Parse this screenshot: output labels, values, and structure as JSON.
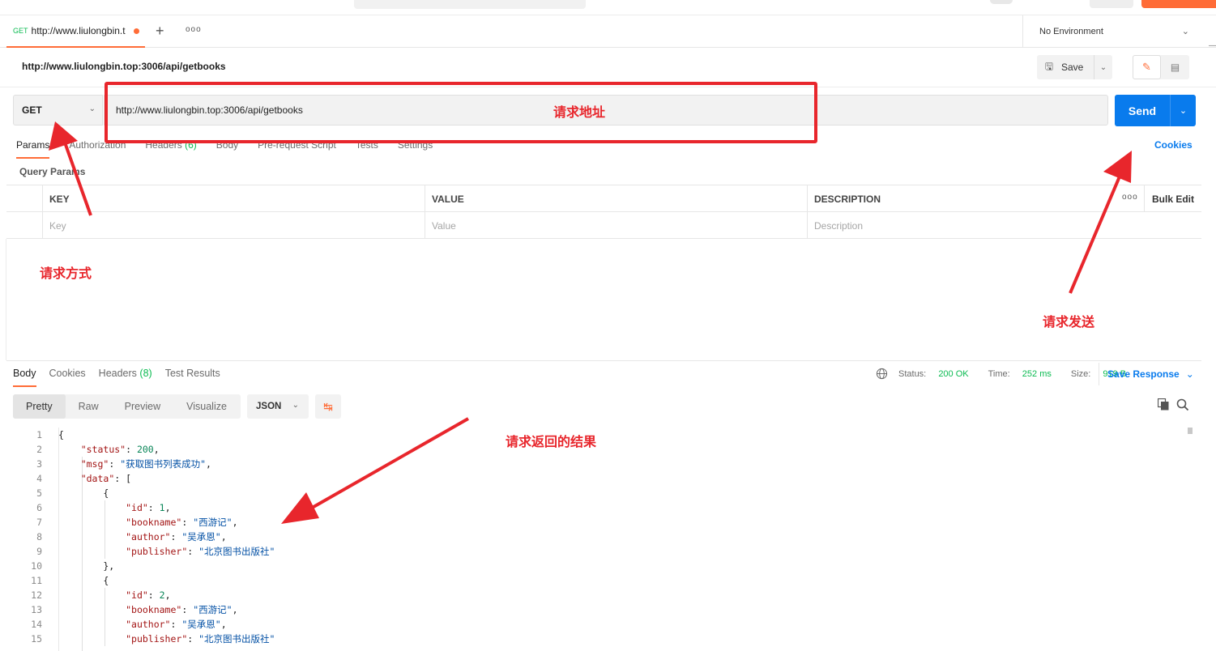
{
  "tabbar": {
    "tab_method": "GET",
    "tab_title": "http://www.liulongbin.t",
    "new_tab": "+",
    "more_tabs": "ooo",
    "environment": "No Environment"
  },
  "request": {
    "title_url": "http://www.liulongbin.top:3006/api/getbooks",
    "save_label": "Save",
    "method": "GET",
    "url": "http://www.liulongbin.top:3006/api/getbooks",
    "send_label": "Send",
    "tabs": [
      "Params",
      "Authorization",
      "Headers",
      "Body",
      "Pre-request Script",
      "Tests",
      "Settings"
    ],
    "headers_count": "(6)",
    "cookies_link": "Cookies",
    "query_params_title": "Query Params",
    "params_table": {
      "headers": [
        "KEY",
        "VALUE",
        "DESCRIPTION"
      ],
      "placeholders": [
        "Key",
        "Value",
        "Description"
      ],
      "more": "ooo",
      "bulk_edit": "Bulk Edit"
    }
  },
  "response": {
    "tabs": [
      "Body",
      "Cookies",
      "Headers",
      "Test Results"
    ],
    "headers_count": "(8)",
    "status_label": "Status:",
    "status_value": "200 OK",
    "time_label": "Time:",
    "time_value": "252 ms",
    "size_label": "Size:",
    "size_value": "919 B",
    "save_response": "Save Response",
    "view_modes": [
      "Pretty",
      "Raw",
      "Preview",
      "Visualize"
    ],
    "format": "JSON",
    "code_lines": [
      "{",
      "    \"status\": 200,",
      "    \"msg\": \"获取图书列表成功\",",
      "    \"data\": [",
      "        {",
      "            \"id\": 1,",
      "            \"bookname\": \"西游记\",",
      "            \"author\": \"吴承恩\",",
      "            \"publisher\": \"北京图书出版社\"",
      "        },",
      "        {",
      "            \"id\": 2,",
      "            \"bookname\": \"西游记\",",
      "            \"author\": \"吴承恩\",",
      "            \"publisher\": \"北京图书出版社\""
    ]
  },
  "annotations": {
    "url_label": "请求地址",
    "method_label": "请求方式",
    "send_label": "请求发送",
    "result_label": "请求返回的结果",
    "color": "#e8262c"
  },
  "colors": {
    "accent": "#ff6c37",
    "send": "#097bed",
    "ok": "#0cbb52"
  }
}
